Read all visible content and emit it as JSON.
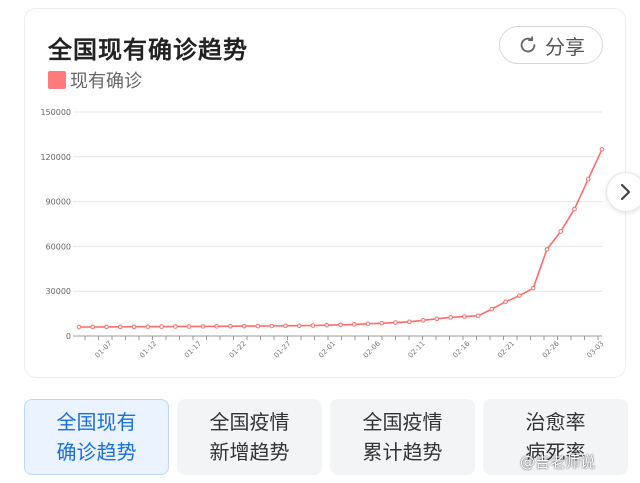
{
  "header": {
    "title": "全国现有确诊趋势",
    "share_label": "分享"
  },
  "legend": {
    "label": "现有确诊",
    "color": "#ff7b7b"
  },
  "chart_data": {
    "type": "line",
    "series": [
      {
        "name": "现有确诊",
        "color": "#ff6b6b",
        "values": [
          6000,
          6050,
          6100,
          6150,
          6200,
          6250,
          6300,
          6350,
          6400,
          6450,
          6500,
          6550,
          6600,
          6650,
          6700,
          6800,
          6900,
          7000,
          7200,
          7500,
          7800,
          8200,
          8600,
          9000,
          9500,
          10500,
          11500,
          12500,
          13000,
          13500,
          18000,
          23000,
          27000,
          32000,
          58000,
          70000,
          85000,
          105000,
          125000
        ]
      }
    ],
    "x_tick_labels": [
      "01-07",
      "01-12",
      "01-17",
      "01-22",
      "01-27",
      "02-01",
      "02-06",
      "02-11",
      "02-16",
      "02-21",
      "02-26",
      "03-03"
    ],
    "y_ticks": [
      0,
      30000,
      60000,
      90000,
      120000,
      150000
    ],
    "y_tick_labels": [
      "0",
      "30000",
      "60000",
      "90000",
      "120000",
      "150000"
    ],
    "ylim": [
      0,
      150000
    ],
    "grid": true,
    "legend_position": "top-left"
  },
  "tabs": [
    {
      "label": "全国现有\n确诊趋势",
      "active": true
    },
    {
      "label": "全国疫情\n新增趋势",
      "active": false
    },
    {
      "label": "全国疫情\n累计趋势",
      "active": false
    },
    {
      "label": "治愈率\n病死率",
      "active": false
    }
  ],
  "watermark": "@吉老师说",
  "icons": {
    "share": "refresh-arrow-icon",
    "next": "chevron-right-icon"
  }
}
